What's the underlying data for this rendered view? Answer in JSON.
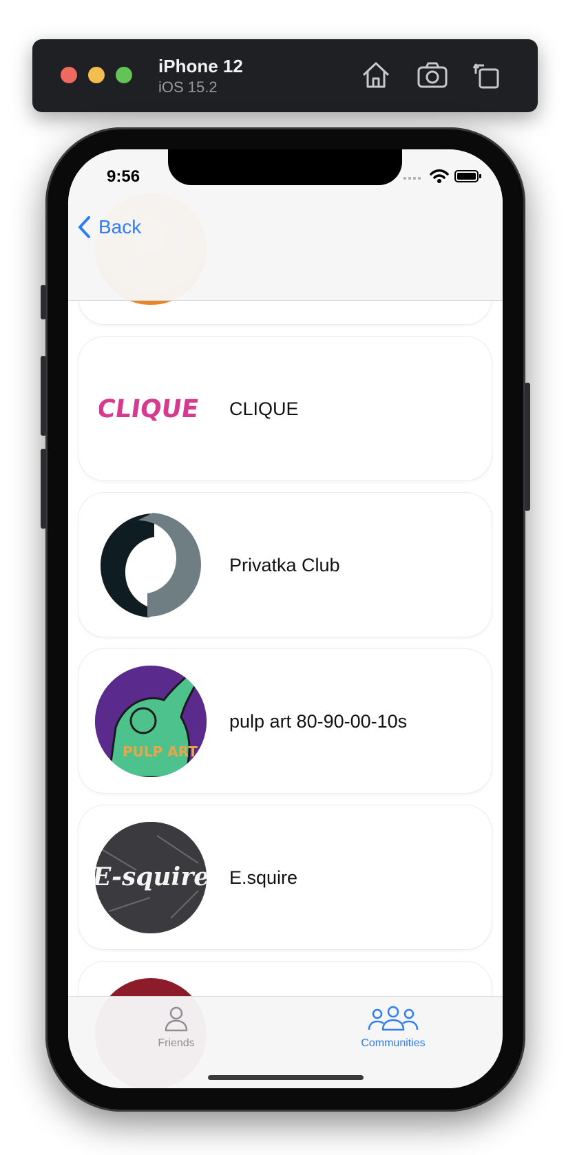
{
  "simulator": {
    "device_name": "iPhone 12",
    "os_version": "iOS 15.2",
    "toolbar_icons": [
      "home-icon",
      "screenshot-icon",
      "rotate-icon"
    ]
  },
  "status_bar": {
    "time": "9:56"
  },
  "nav": {
    "back_label": "Back"
  },
  "communities": [
    {
      "name": "CLIQUE",
      "logo_text": "CLIQUE"
    },
    {
      "name": "Privatka Club"
    },
    {
      "name": "pulp art 80-90-00-10s",
      "logo_text": "PULP ART"
    },
    {
      "name": "E.squire",
      "logo_text": "E-squire"
    }
  ],
  "tabs": [
    {
      "label": "Friends",
      "icon": "person-icon",
      "selected": false
    },
    {
      "label": "Communities",
      "icon": "people-group-icon",
      "selected": true
    }
  ],
  "colors": {
    "accent": "#2f7cf6",
    "inactive_tab": "#8e8e93",
    "clique_pink": "#d63a8f"
  }
}
